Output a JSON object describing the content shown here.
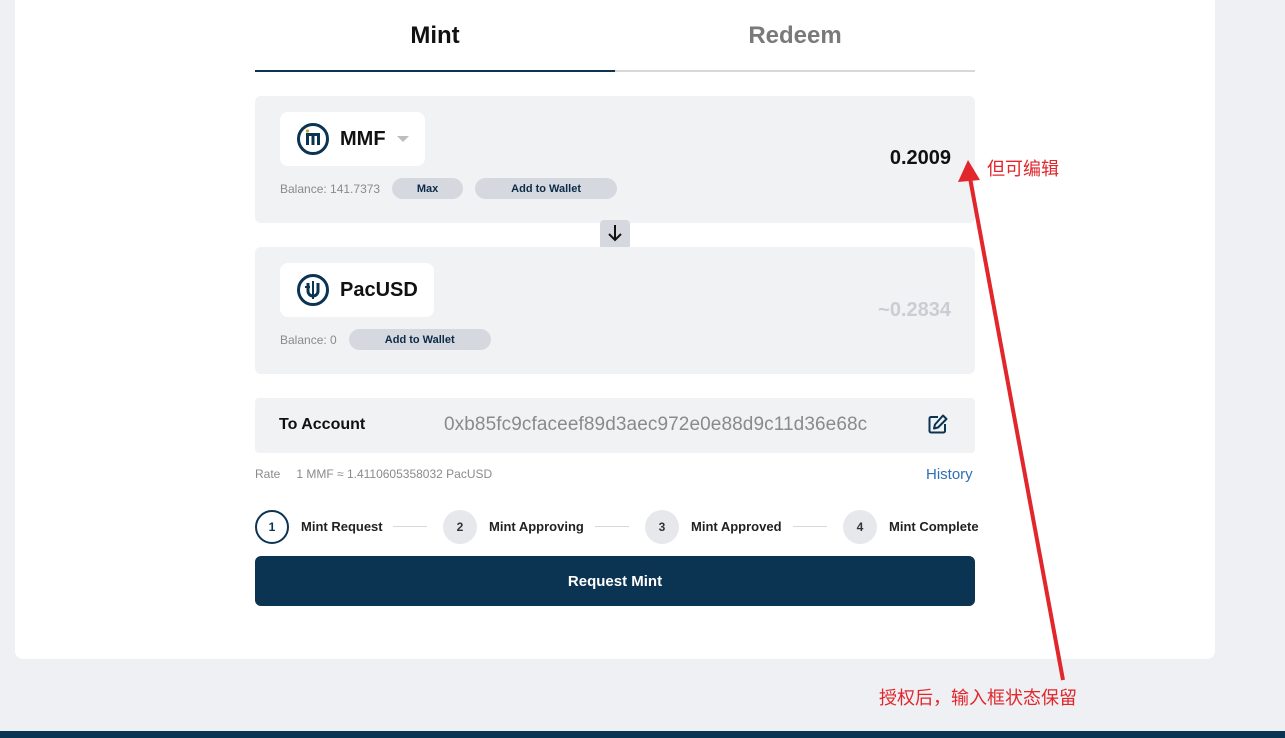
{
  "tabs": [
    {
      "label": "Mint",
      "active": true
    },
    {
      "label": "Redeem",
      "active": false
    }
  ],
  "from": {
    "token": "MMF",
    "balance": "Balance: 141.7373",
    "max_label": "Max",
    "add_wallet_label": "Add to Wallet",
    "amount": "0.2009"
  },
  "to": {
    "token": "PacUSD",
    "balance": "Balance: 0",
    "add_wallet_label": "Add to Wallet",
    "amount": "~0.2834"
  },
  "account": {
    "label": "To Account",
    "address": "0xb85fc9cfaceef89d3aec972e0e88d9c11d36e68c"
  },
  "rate": {
    "label": "Rate",
    "value": "1 MMF ≈ 1.4110605358032 PacUSD"
  },
  "history_label": "History",
  "steps": [
    {
      "num": "1",
      "label": "Mint Request",
      "active": true
    },
    {
      "num": "2",
      "label": "Mint Approving",
      "active": false
    },
    {
      "num": "3",
      "label": "Mint Approved",
      "active": false
    },
    {
      "num": "4",
      "label": "Mint Complete",
      "active": false
    }
  ],
  "submit_label": "Request Mint",
  "annotations": {
    "top": "但可编辑",
    "bottom": "授权后，输入框状态保留",
    "color": "#e1262c"
  },
  "colors": {
    "primary": "#0b3352",
    "link": "#2f6fb5",
    "panel": "#f1f2f4"
  }
}
